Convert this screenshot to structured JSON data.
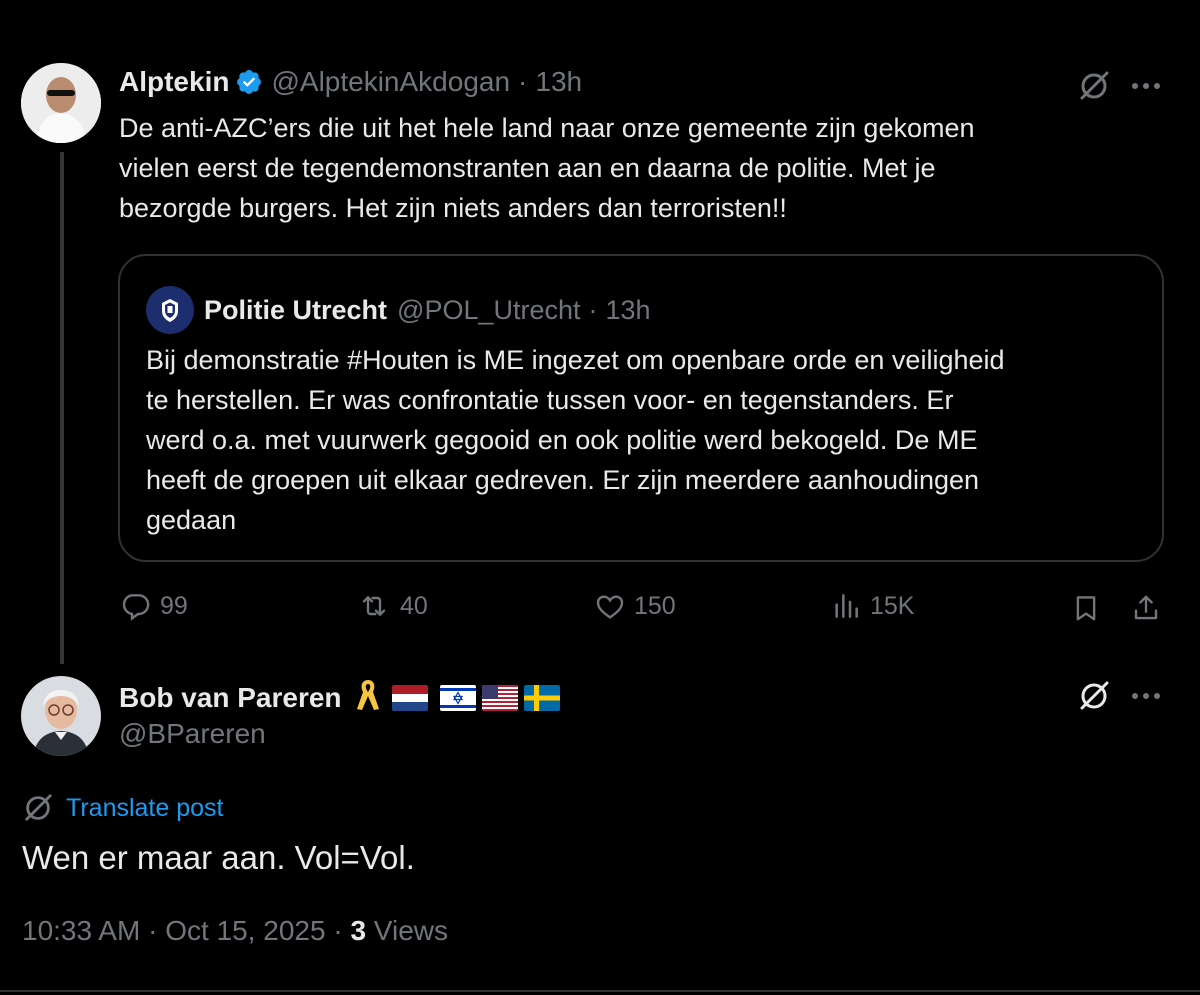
{
  "tweet1": {
    "name": "Alptekin",
    "handle": "@AlptekinAkdogan",
    "dot": "·",
    "time": "13h",
    "lines": [
      "De anti-AZC’ers die uit het hele land naar onze gemeente zijn gekomen",
      "vielen eerst de tegendemonstranten aan en daarna de politie. Met je",
      "bezorgde burgers. Het zijn niets anders dan terroristen!!"
    ]
  },
  "quote": {
    "name": "Politie Utrecht",
    "handle": "@POL_Utrecht",
    "dot": "·",
    "time": "13h",
    "lines": [
      "Bij demonstratie #Houten is ME ingezet om openbare orde en veiligheid",
      "te herstellen. Er was confrontatie tussen voor- en tegenstanders. Er",
      "werd o.a. met vuurwerk gegooid en ook politie werd bekogeld. De ME",
      "heeft de groepen uit elkaar gedreven. Er zijn meerdere aanhoudingen",
      "gedaan"
    ]
  },
  "actions": {
    "replies": "99",
    "reposts": "40",
    "likes": "150",
    "views": "15K"
  },
  "tweet2": {
    "name": "Bob van Pareren",
    "handle": "@BPareren",
    "translate_label": "Translate post",
    "text": "Wen er maar aan. Vol=Vol.",
    "time": "10:33 AM",
    "date": "Oct 15, 2025",
    "views_count": "3",
    "views_label": "Views",
    "sep": "·"
  },
  "colors": {
    "background": "#000000",
    "text": "#e7e9ea",
    "muted": "#71767b",
    "accent": "#1d9bf0",
    "border": "#2f3336"
  },
  "icons": [
    "grok-icon",
    "more-icon",
    "verified-badge-icon",
    "reply-icon",
    "repost-icon",
    "like-icon",
    "views-icon",
    "bookmark-icon",
    "share-icon",
    "translate-icon",
    "ribbon-icon"
  ]
}
